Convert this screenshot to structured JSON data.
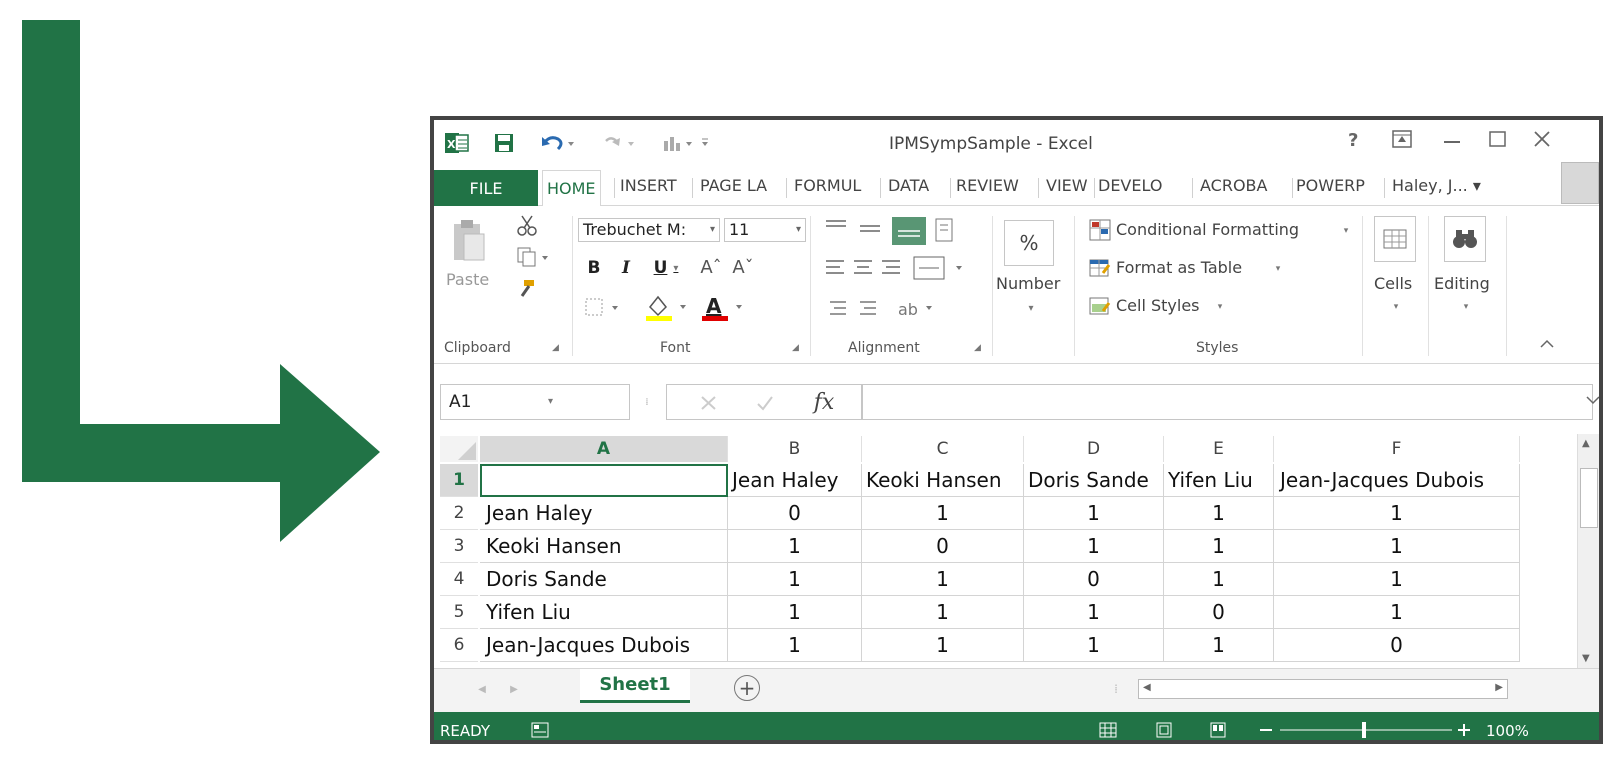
{
  "window": {
    "title": "IPMSympSample - Excel",
    "help": "?",
    "user": "Haley, J...",
    "accent": "#217346"
  },
  "tabs": [
    "FILE",
    "HOME",
    "INSERT",
    "PAGE LA",
    "FORMUL",
    "DATA",
    "REVIEW",
    "VIEW",
    "DEVELO",
    "ACROBA",
    "POWERP"
  ],
  "ribbon": {
    "clipboard": {
      "paste": "Paste",
      "label": "Clipboard"
    },
    "font": {
      "name": "Trebuchet M:",
      "size": "11",
      "label": "Font"
    },
    "alignment": {
      "label": "Alignment"
    },
    "number": {
      "symbol": "%",
      "label": "Number"
    },
    "styles": {
      "conditional": "Conditional Formatting",
      "format_table": "Format as Table",
      "cell_styles": "Cell Styles",
      "label": "Styles"
    },
    "cells": {
      "label": "Cells"
    },
    "editing": {
      "label": "Editing"
    }
  },
  "formula_bar": {
    "name_box": "A1",
    "fx": "fx",
    "value": ""
  },
  "sheet": {
    "columns": [
      "A",
      "B",
      "C",
      "D",
      "E",
      "F"
    ],
    "rows": [
      {
        "num": "1",
        "cells": [
          "",
          "Jean Haley",
          "Keoki Hansen",
          "Doris Sande",
          "Yifen Liu",
          "Jean-Jacques Dubois"
        ]
      },
      {
        "num": "2",
        "cells": [
          "Jean Haley",
          "0",
          "1",
          "1",
          "1",
          "1"
        ]
      },
      {
        "num": "3",
        "cells": [
          "Keoki Hansen",
          "1",
          "0",
          "1",
          "1",
          "1"
        ]
      },
      {
        "num": "4",
        "cells": [
          "Doris Sande",
          "1",
          "1",
          "0",
          "1",
          "1"
        ]
      },
      {
        "num": "5",
        "cells": [
          "Yifen Liu",
          "1",
          "1",
          "1",
          "0",
          "1"
        ]
      },
      {
        "num": "6",
        "cells": [
          "Jean-Jacques Dubois",
          "1",
          "1",
          "1",
          "1",
          "0"
        ]
      }
    ]
  },
  "sheet_tabs": {
    "active": "Sheet1",
    "add": "+"
  },
  "status": {
    "ready": "READY",
    "zoom": "100%"
  }
}
